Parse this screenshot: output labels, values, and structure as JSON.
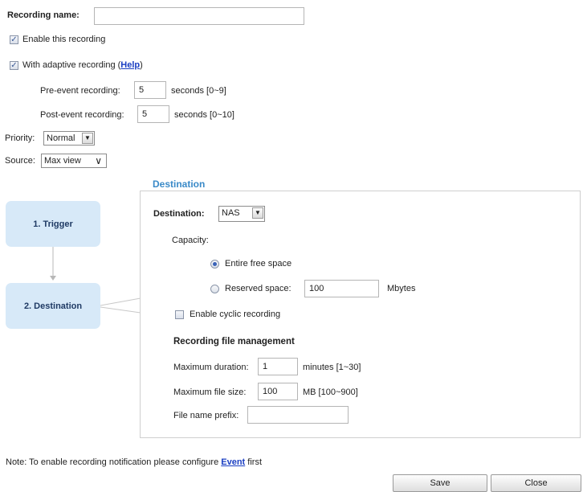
{
  "recording": {
    "name_label": "Recording name:",
    "name_value": "",
    "enable_label": "Enable this recording",
    "enable_checked": true,
    "adaptive_label": "With adaptive recording (",
    "adaptive_help": "Help",
    "adaptive_close": ")",
    "adaptive_checked": true,
    "pre_event_label": "Pre-event recording:",
    "pre_event_value": "5",
    "pre_event_unit": "seconds [0~9]",
    "post_event_label": "Post-event recording:",
    "post_event_value": "5",
    "post_event_unit": "seconds [0~10]",
    "priority_label": "Priority:",
    "priority_value": "Normal",
    "source_label": "Source:",
    "source_value": "Max view"
  },
  "steps": {
    "trigger": "1. Trigger",
    "destination": "2. Destination"
  },
  "destination": {
    "legend": "Destination",
    "dest_label": "Destination:",
    "dest_value": "NAS",
    "capacity_label": "Capacity:",
    "entire_label": "Entire free space",
    "reserved_label": "Reserved space:",
    "reserved_value": "100",
    "reserved_unit": "Mbytes",
    "cyclic_label": "Enable cyclic recording",
    "cyclic_checked": false,
    "file_mgmt_title": "Recording file management",
    "max_duration_label": "Maximum duration:",
    "max_duration_value": "1",
    "max_duration_unit": "minutes [1~30]",
    "max_size_label": "Maximum file size:",
    "max_size_value": "100",
    "max_size_unit": "MB [100~900]",
    "prefix_label": "File name prefix:",
    "prefix_value": ""
  },
  "note": {
    "prefix": "Note: To enable recording notification please configure ",
    "link": "Event",
    "suffix": " first"
  },
  "buttons": {
    "save": "Save",
    "close": "Close"
  },
  "colors": {
    "step_bg": "#d7e9f8",
    "legend": "#3a8ac8",
    "link": "#1a3ec2"
  }
}
